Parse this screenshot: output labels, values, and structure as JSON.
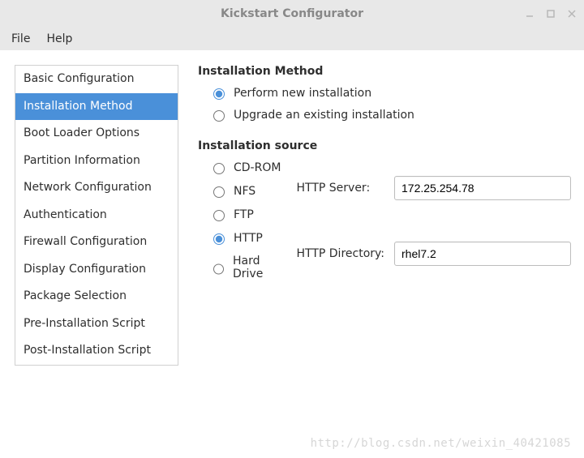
{
  "window": {
    "title": "Kickstart Configurator"
  },
  "menu": {
    "file": "File",
    "help": "Help"
  },
  "sidebar": {
    "items": [
      {
        "label": "Basic Configuration",
        "selected": false
      },
      {
        "label": "Installation Method",
        "selected": true
      },
      {
        "label": "Boot Loader Options",
        "selected": false
      },
      {
        "label": "Partition Information",
        "selected": false
      },
      {
        "label": "Network Configuration",
        "selected": false
      },
      {
        "label": "Authentication",
        "selected": false
      },
      {
        "label": "Firewall Configuration",
        "selected": false
      },
      {
        "label": "Display Configuration",
        "selected": false
      },
      {
        "label": "Package Selection",
        "selected": false
      },
      {
        "label": "Pre-Installation Script",
        "selected": false
      },
      {
        "label": "Post-Installation Script",
        "selected": false
      }
    ]
  },
  "install_method": {
    "heading": "Installation Method",
    "options": {
      "new": "Perform new installation",
      "upgrade": "Upgrade an existing installation"
    },
    "selected": "new"
  },
  "install_source": {
    "heading": "Installation source",
    "options": {
      "cdrom": "CD-ROM",
      "nfs": "NFS",
      "ftp": "FTP",
      "http": "HTTP",
      "harddrive": "Hard Drive"
    },
    "selected": "http"
  },
  "http": {
    "server_label": "HTTP Server:",
    "server_value": "172.25.254.78",
    "dir_label": "HTTP Directory:",
    "dir_value": "rhel7.2"
  },
  "watermark": "http://blog.csdn.net/weixin_40421085"
}
